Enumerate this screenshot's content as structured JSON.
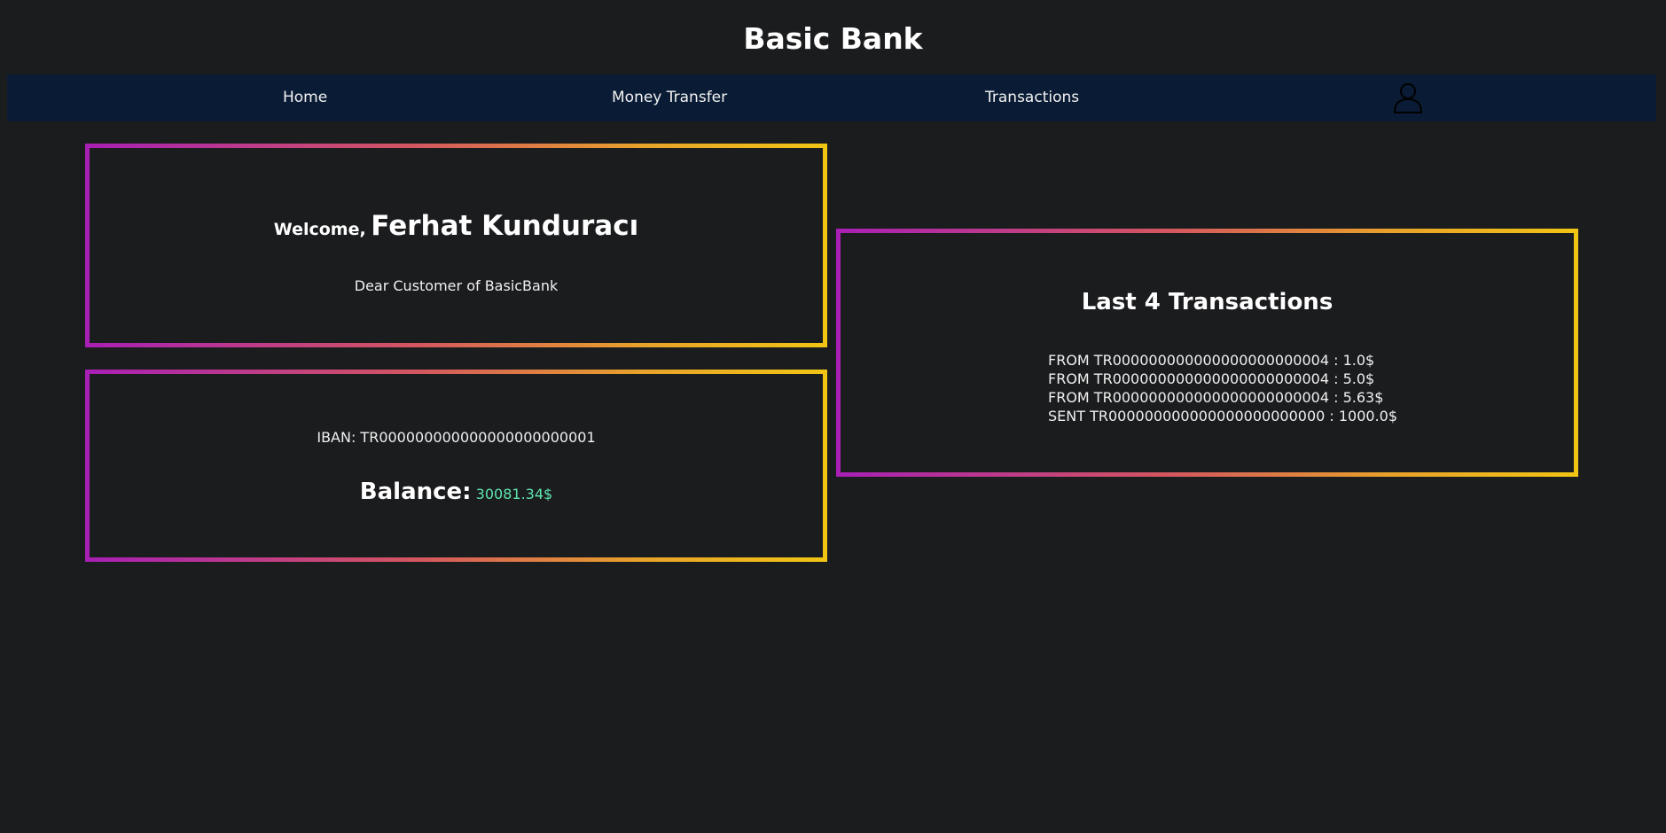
{
  "header": {
    "title": "Basic Bank"
  },
  "nav": {
    "home": "Home",
    "money_transfer": "Money Transfer",
    "transactions": "Transactions",
    "profile_icon": "user-icon"
  },
  "welcome": {
    "greeting": "Welcome,",
    "name": "Ferhat Kunduracı",
    "subtitle": "Dear Customer of BasicBank"
  },
  "account": {
    "iban": "IBAN: TR000000000000000000000001",
    "balance_label": "Balance:",
    "balance_value": "30081.34$"
  },
  "transactions": {
    "title": "Last 4 Transactions",
    "items": [
      "FROM TR000000000000000000000004 : 1.0$",
      "FROM TR000000000000000000000004 : 5.0$",
      "FROM TR000000000000000000000004 : 5.63$",
      "SENT TR000000000000000000000000 : 1000.0$"
    ]
  },
  "colors": {
    "background": "#1b1c1e",
    "navbar": "#0a1c35",
    "gradient_start": "#a81fb5",
    "gradient_end": "#f1c514",
    "balance_value": "#5ee6b0"
  }
}
